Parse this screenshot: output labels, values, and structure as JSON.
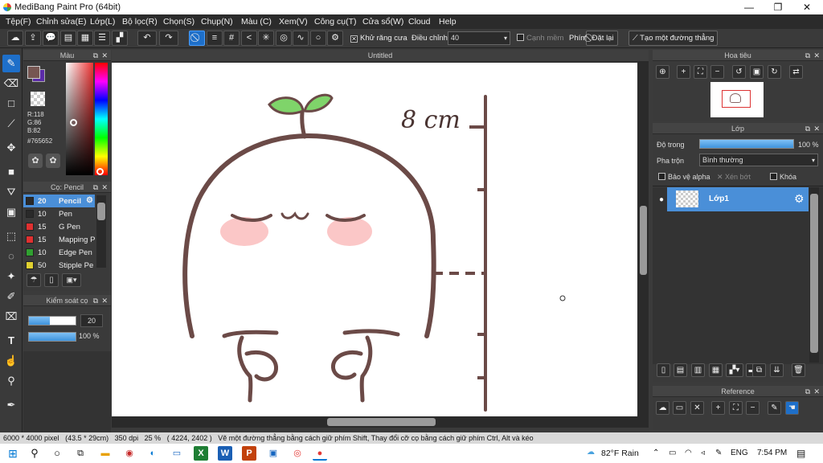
{
  "window": {
    "title": "MediBang Paint Pro (64bit)",
    "minimize": "—",
    "maximize": "❐",
    "close": "✕"
  },
  "menu": [
    "Tệp(F)",
    "Chỉnh sửa(E)",
    "Lớp(L)",
    "Bộ lọc(R)",
    "Chọn(S)",
    "Chụp(N)",
    "Màu (C)",
    "Xem(V)",
    "Công cụ(T)",
    "Cửa sổ(W)",
    "Cloud",
    "Help"
  ],
  "toolbar": {
    "antialias_label": "Khử răng cưa",
    "adjust_label": "Điều chỉnh",
    "adjust_value": "40",
    "soft_edge_label": "Cạnh mềm",
    "key_label": "Phím",
    "reset_label": "Đặt lại",
    "straight_line_label": "Tạo một đường thẳng"
  },
  "color_panel": {
    "title": "Màu",
    "r": "R:118",
    "g": "G:86",
    "b": "B:82",
    "hex": "#765652",
    "fg_color": "#765652",
    "bg_color": "#5b2ba8"
  },
  "brush_panel": {
    "title": "Cọ: Pencil",
    "items": [
      {
        "size": "20",
        "name": "Pencil",
        "color": "#2a2a2a",
        "selected": true
      },
      {
        "size": "10",
        "name": "Pen",
        "color": "#2a2a2a"
      },
      {
        "size": "15",
        "name": "G Pen",
        "color": "#e03030"
      },
      {
        "size": "15",
        "name": "Mapping P",
        "color": "#e03030"
      },
      {
        "size": "10",
        "name": "Edge Pen",
        "color": "#30a030"
      },
      {
        "size": "50",
        "name": "Stipple Pe",
        "color": "#e0d030"
      }
    ]
  },
  "brush_control": {
    "title": "Kiểm soát cọ",
    "size": "20",
    "opacity": "100 %",
    "size_fraction": 0.45,
    "opacity_fraction": 1.0
  },
  "canvas": {
    "tab_title": "Untitled",
    "label": "8 cm"
  },
  "navigator": {
    "title": "Hoa tiêu"
  },
  "layer_panel": {
    "title": "Lớp",
    "opacity_label": "Độ trong",
    "opacity_value": "100 %",
    "blend_label": "Pha trộn",
    "blend_value": "Bình thường",
    "protect_alpha": "Bảo vệ alpha",
    "clip": "Xén bớt",
    "lock": "Khóa",
    "layer_name": "Lớp1"
  },
  "reference": {
    "title": "Reference"
  },
  "status": {
    "size": "6000 * 4000 pixel",
    "cm": "(43.5 * 29cm)",
    "dpi": "350 dpi",
    "zoom": "25 %",
    "coords": "( 4224, 2402 )",
    "hint": "Vẽ một đường thẳng bằng cách giữ phím Shift, Thay đổi cỡ cọ bằng cách giữ phím Ctrl, Alt và kéo"
  },
  "taskbar": {
    "weather": "82°F  Rain",
    "lang": "ENG",
    "time": "7:54 PM"
  }
}
